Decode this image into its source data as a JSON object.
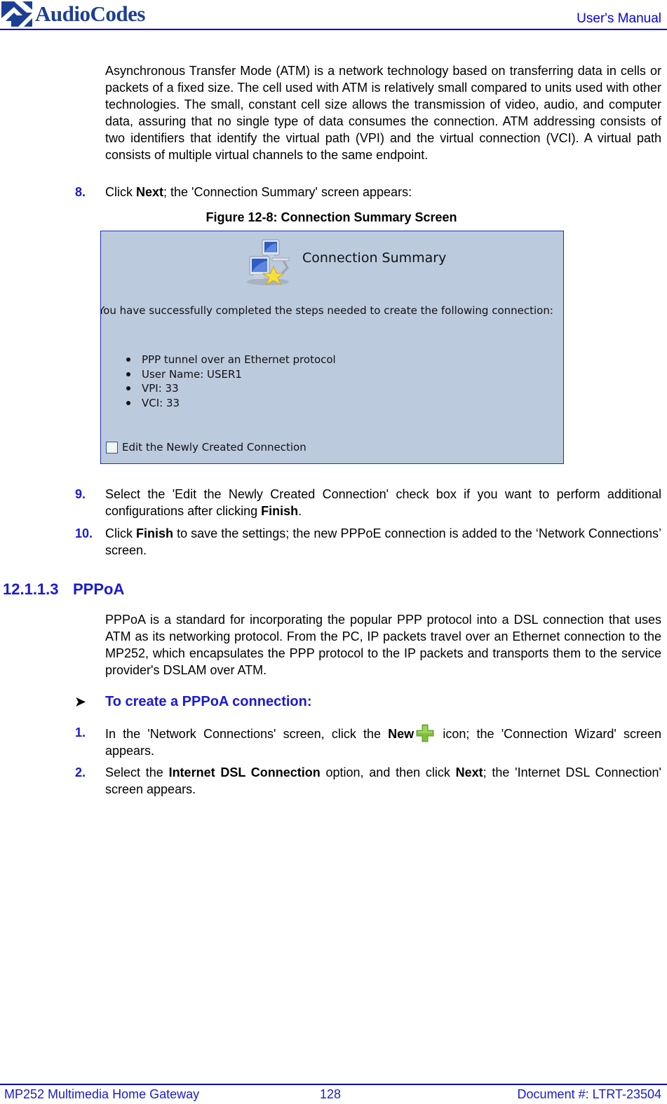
{
  "header": {
    "logo_text": "AudioCodes",
    "manual_label": "User's Manual"
  },
  "intro_paragraph": "Asynchronous Transfer Mode (ATM) is a network technology based on transferring data in cells or packets of a fixed size. The cell used with ATM is relatively small compared to units used with other technologies. The small, constant cell size allows the transmission of video, audio, and computer data, assuring that no single type of data consumes the connection. ATM addressing consists of two identifiers that identify the virtual path (VPI) and the virtual connection (VCI). A virtual path consists of multiple virtual channels to the same endpoint.",
  "steps_top": [
    {
      "num": "8.",
      "pre": "Click ",
      "bold": "Next",
      "post": "; the 'Connection Summary' screen appears:"
    },
    {
      "num": "9.",
      "pre": "Select the 'Edit the Newly Created Connection' check box if you want to perform additional configurations after clicking ",
      "bold": "Finish",
      "post": "."
    },
    {
      "num": "10.",
      "pre": "Click ",
      "bold": "Finish",
      "post": " to save the settings; the new PPPoE connection is added to the ‘Network Connections’ screen."
    }
  ],
  "figure": {
    "caption": "Figure 12-8: Connection Summary Screen",
    "screen_title": "Connection Summary",
    "message": "You have successfully completed the steps needed to create the following connection:",
    "items": [
      "PPP tunnel over an Ethernet protocol",
      "User Name: USER1",
      "VPI: 33",
      "VCI: 33"
    ],
    "checkbox_label": "Edit the Newly Created Connection",
    "checkbox_checked": false
  },
  "section": {
    "number": "12.1.1.3",
    "title": "PPPoA",
    "paragraph": "PPPoA is a standard for incorporating the popular PPP protocol into a DSL connection that uses ATM as its networking protocol. From the PC, IP packets travel over an Ethernet connection to the MP252, which encapsulates the PPP protocol to the IP packets and transports them to the service provider's DSLAM over ATM.",
    "procedure_title": "To create a PPPoA connection:",
    "steps": [
      {
        "num": "1.",
        "pre": "In the 'Network Connections' screen, click the ",
        "bold": "New",
        "post": " icon; the 'Connection Wizard' screen appears."
      },
      {
        "num": "2.",
        "pre": "Select the ",
        "bold": "Internet DSL Connection",
        "mid": " option, and then click ",
        "bold2": "Next",
        "post": "; the 'Internet DSL Connection' screen appears."
      }
    ]
  },
  "footer": {
    "product": "MP252 Multimedia Home Gateway",
    "page": "128",
    "document": "Document #: LTRT-23504"
  }
}
